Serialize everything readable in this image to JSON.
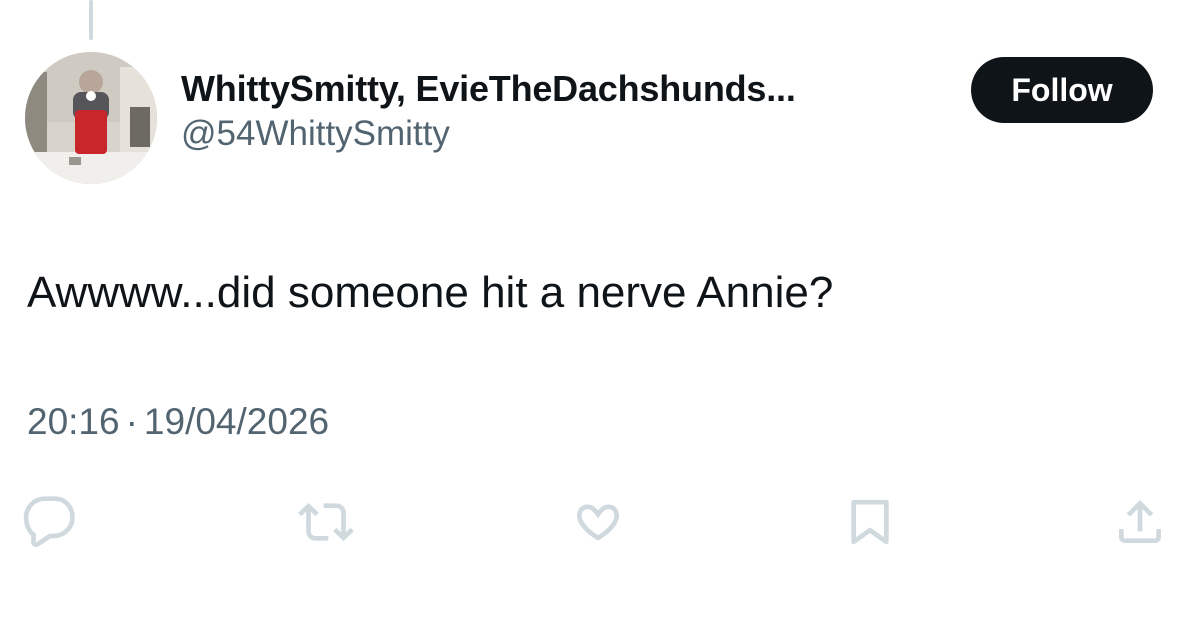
{
  "author": {
    "display_name": "WhittySmitty, EvieTheDachshunds...",
    "handle": "@54WhittySmitty",
    "follow_label": "Follow"
  },
  "tweet": {
    "text": "Awwww...did someone hit a nerve Annie?",
    "time": "20:16",
    "separator": "·",
    "date": "19/04/2026"
  },
  "actions": [
    {
      "icon": "reply-icon"
    },
    {
      "icon": "retweet-icon"
    },
    {
      "icon": "like-icon"
    },
    {
      "icon": "bookmark-icon"
    },
    {
      "icon": "share-icon"
    }
  ],
  "colors": {
    "text": "#0f1419",
    "secondary": "#536471",
    "icon": "#cfd9de",
    "button_bg": "#0f1419",
    "button_text": "#ffffff"
  }
}
